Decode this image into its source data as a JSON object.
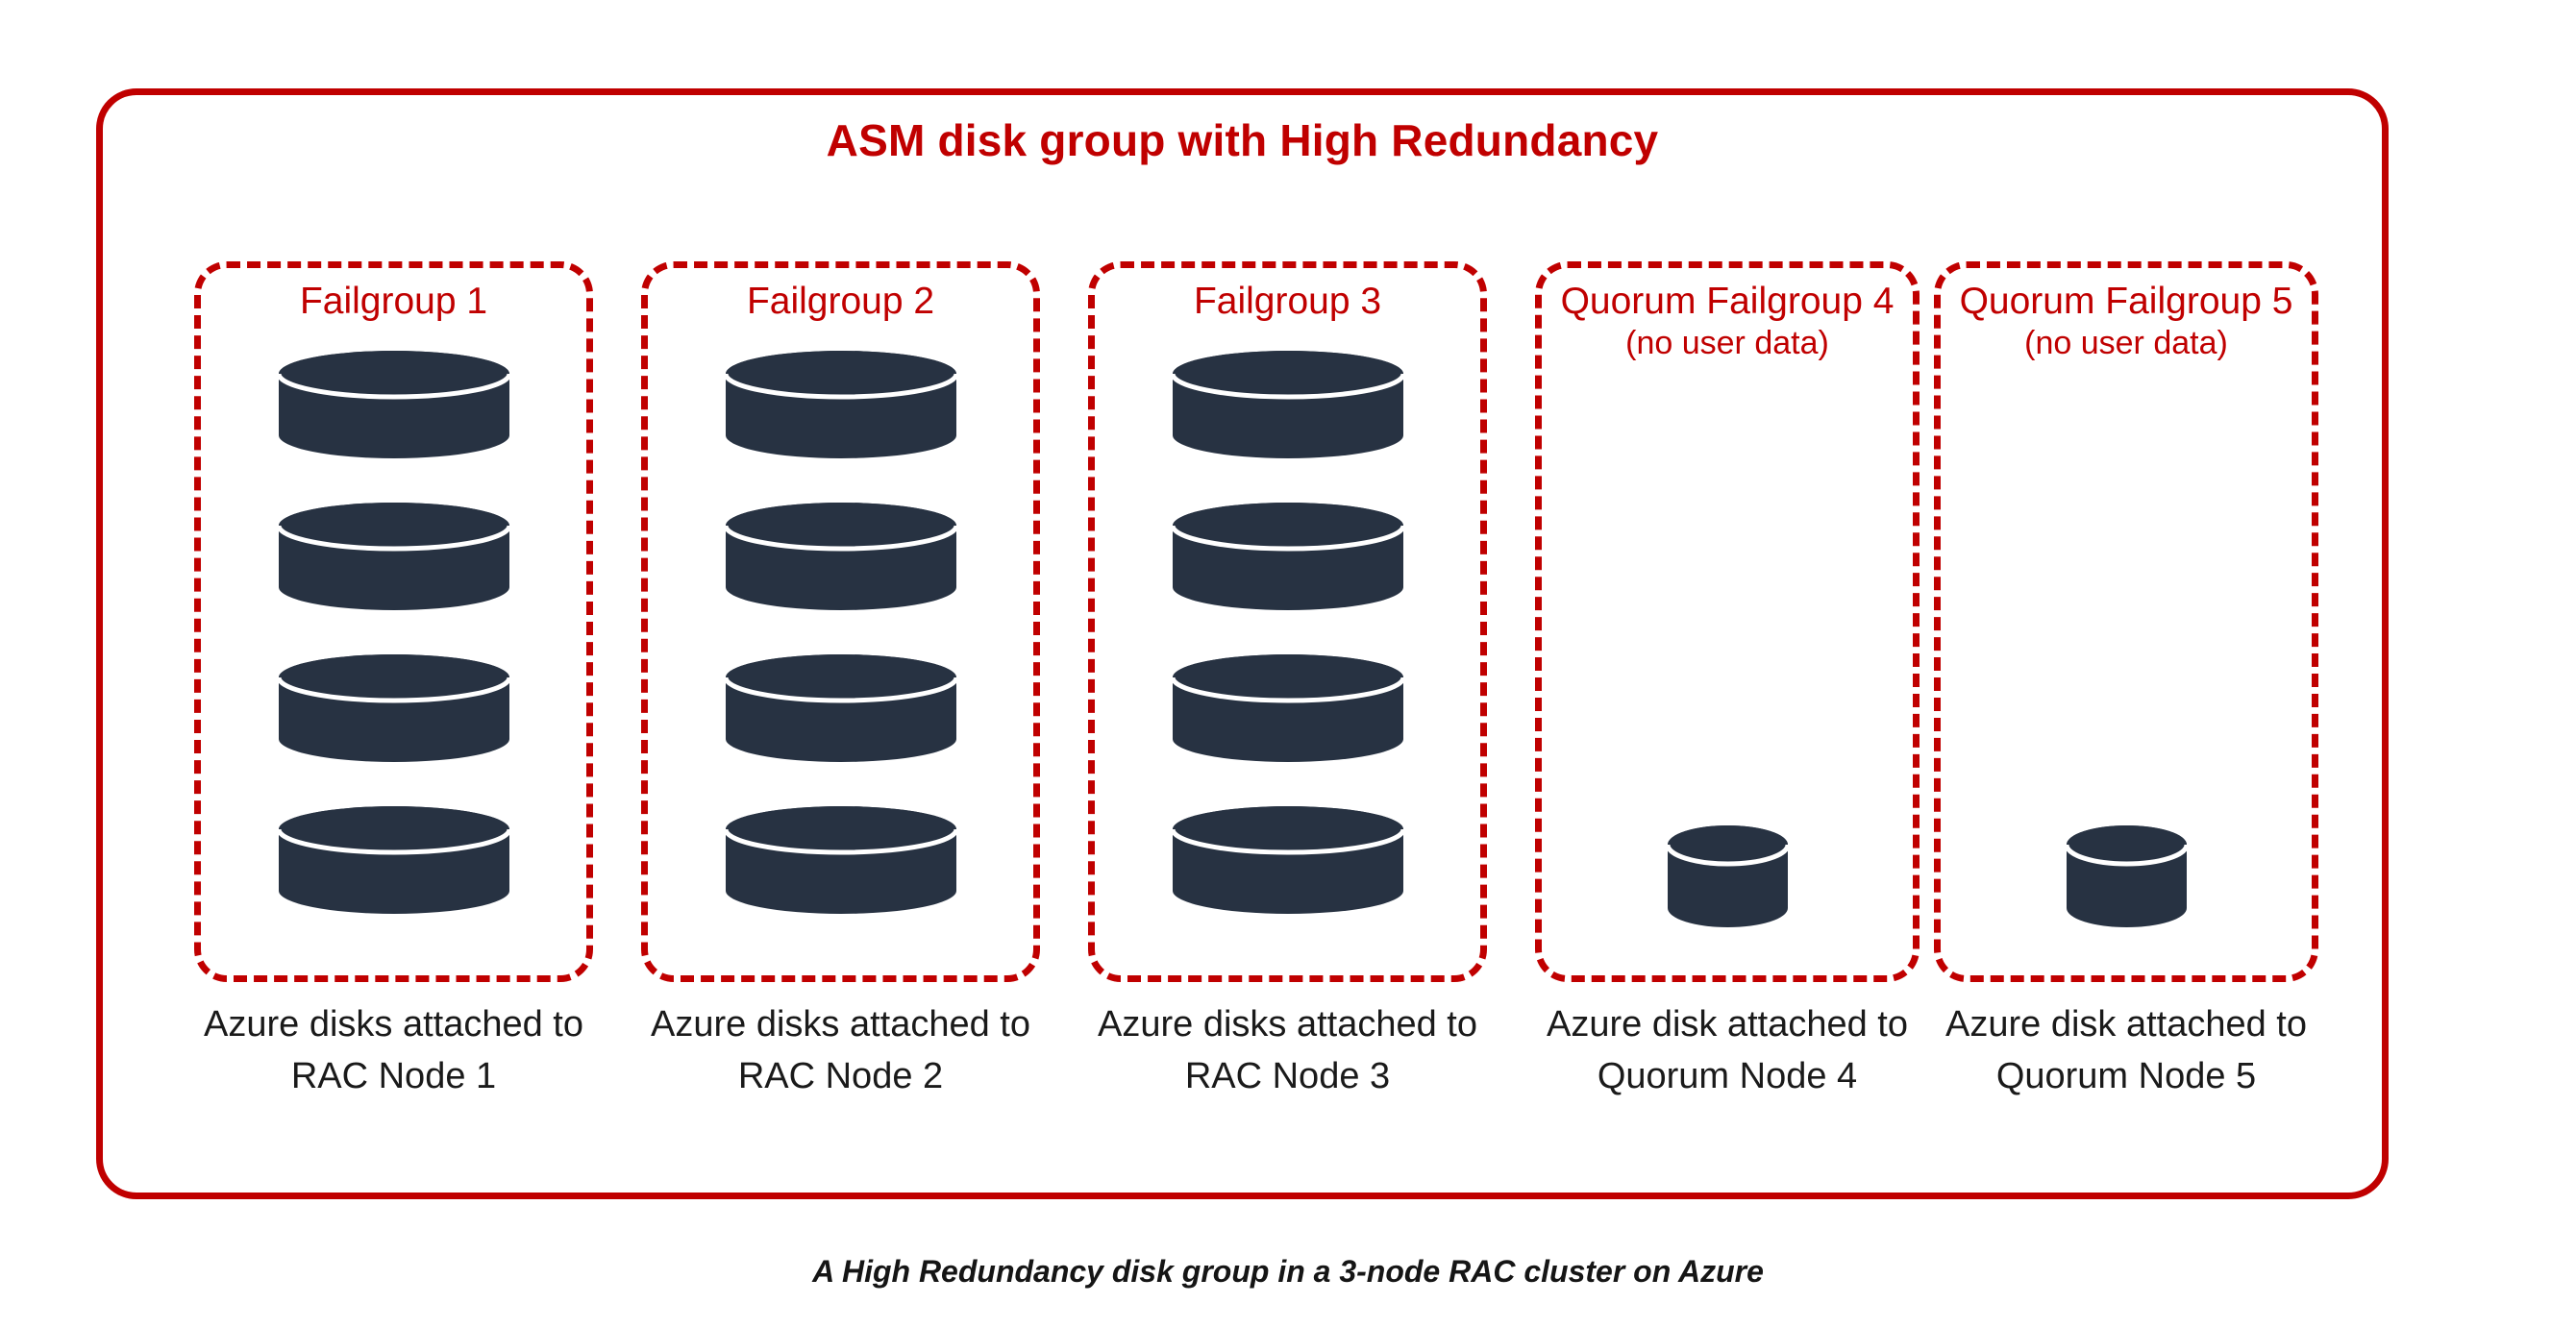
{
  "diagram": {
    "title": "ASM disk group with High Redundancy",
    "caption": "A High Redundancy disk group in a 3-node RAC cluster on Azure",
    "colors": {
      "accent_red": "#C00000",
      "disk_navy": "#273242",
      "background": "#FFFFFF",
      "caption_text": "#151515"
    }
  },
  "failgroups": [
    {
      "label": "Failgroup 1",
      "sublabel": "",
      "disk_count": 4,
      "disk_size": "large",
      "node_caption": "Azure disks attached to RAC Node 1"
    },
    {
      "label": "Failgroup 2",
      "sublabel": "",
      "disk_count": 4,
      "disk_size": "large",
      "node_caption": "Azure disks attached to RAC Node 2"
    },
    {
      "label": "Failgroup 3",
      "sublabel": "",
      "disk_count": 4,
      "disk_size": "large",
      "node_caption": "Azure disks attached to RAC Node 3"
    },
    {
      "label": "Quorum Failgroup 4",
      "sublabel": "(no user data)",
      "disk_count": 1,
      "disk_size": "small",
      "node_caption": "Azure disk attached to Quorum Node 4"
    },
    {
      "label": "Quorum Failgroup 5",
      "sublabel": "(no user data)",
      "disk_count": 1,
      "disk_size": "small",
      "node_caption": "Azure disk attached to Quorum Node 5"
    }
  ],
  "icons": {
    "disk": "database-cylinder-icon"
  }
}
